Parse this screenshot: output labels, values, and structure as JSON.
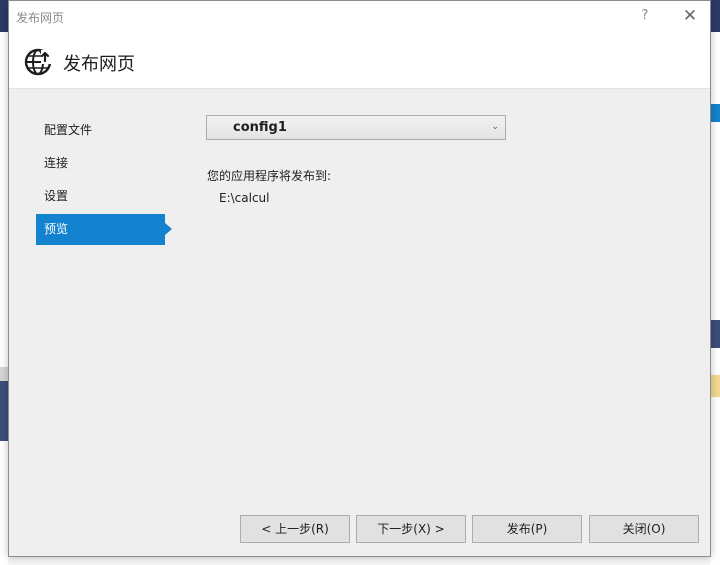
{
  "window": {
    "title": "发布网页",
    "help_glyph": "?",
    "close_glyph": "✕"
  },
  "header": {
    "title": "发布网页",
    "icon": "globe-publish-icon"
  },
  "sidebar": {
    "items": [
      {
        "label": "配置文件",
        "active": false
      },
      {
        "label": "连接",
        "active": false
      },
      {
        "label": "设置",
        "active": false
      },
      {
        "label": "预览",
        "active": true
      }
    ]
  },
  "main": {
    "profile_value": "config1",
    "publish_to_label": "您的应用程序将发布到:",
    "publish_path": "E:\\calcul"
  },
  "footer": {
    "prev_label": "< 上一步(R)",
    "next_label": "下一步(X) >",
    "publish_label": "发布(P)",
    "close_label": "关闭(O)"
  },
  "colors": {
    "accent": "#1382cf",
    "dialog_bg": "#efefef"
  }
}
